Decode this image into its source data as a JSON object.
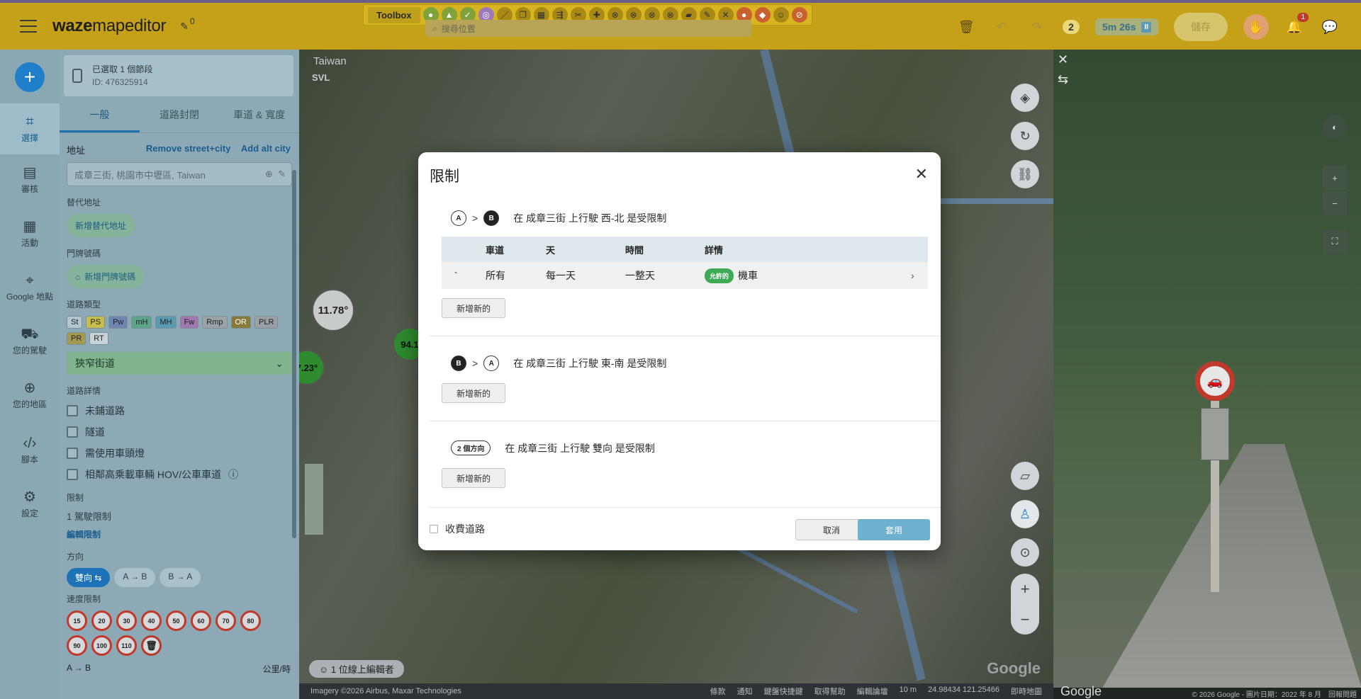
{
  "topbar": {
    "logo_bold": "waze",
    "logo_rest": "mapeditor",
    "edit_count": "0",
    "toolbox_label": "Toolbox",
    "search_placeholder": "搜尋位置",
    "pending_count": "2",
    "timer": "5m 26s",
    "save_label": "儲存",
    "notif_count": "1"
  },
  "rail": {
    "items": [
      {
        "label": "選擇",
        "icon": "select-icon"
      },
      {
        "label": "審核",
        "icon": "review-icon"
      },
      {
        "label": "活動",
        "icon": "calendar-icon"
      },
      {
        "label": "Google 地點",
        "icon": "place-pin-icon"
      },
      {
        "label": "您的駕駛",
        "icon": "car-icon"
      },
      {
        "label": "您的地區",
        "icon": "globe-icon"
      },
      {
        "label": "腳本",
        "icon": "code-icon"
      },
      {
        "label": "設定",
        "icon": "gear-icon"
      }
    ]
  },
  "panel": {
    "selected": "已選取 1 個節段",
    "segment_id": "ID: 476325914",
    "tabs": [
      "一般",
      "道路封閉",
      "車道 & 寬度"
    ],
    "address_label": "地址",
    "remove_street": "Remove street+city",
    "add_alt_city": "Add alt city",
    "address_value": "成章三街, 桃園市中壢區, Taiwan",
    "alt_address_label": "替代地址",
    "add_alt_address": "新增替代地址",
    "house_numbers_label": "門牌號碼",
    "add_house_numbers": "新增門牌號碼",
    "road_type_label": "道路類型",
    "road_types": [
      "St",
      "PS",
      "Pw",
      "mH",
      "MH",
      "Fw",
      "Rmp",
      "OR",
      "PLR",
      "PR",
      "RT"
    ],
    "road_type_value": "狹窄街道",
    "road_details_label": "道路詳情",
    "checkboxes": [
      "未鋪道路",
      "隧道",
      "需使用車頭燈",
      "相鄰高乘載車輛 HOV/公車車道"
    ],
    "restrictions_label": "限制",
    "restrictions_count": "1 駕駛限制",
    "edit_restrictions": "編輯限制",
    "direction_label": "方向",
    "directions": [
      "雙向 ⇆",
      "A → B",
      "B → A"
    ],
    "speed_label": "速度限制",
    "speeds": [
      "15",
      "20",
      "30",
      "40",
      "50",
      "60",
      "70",
      "80",
      "90",
      "100",
      "110"
    ],
    "ab_label": "A → B",
    "ab_value": "公里/時"
  },
  "map": {
    "country": "Taiwan",
    "svl": "SVL",
    "bubble1": "11.78°",
    "bubble2": "94.1",
    "bubble3": "7.23°",
    "editors_online": "1 位線上編輯者",
    "google": "Google",
    "imagery": "Imagery ©2026 Airbus, Maxar Technologies",
    "footer_links": [
      "條款",
      "通知",
      "鍵盤快捷鍵",
      "取得幫助",
      "編輯論壇"
    ],
    "scale": "10 m",
    "coords": "24.98434 121.25466",
    "live_map": "即時地圖"
  },
  "streetview": {
    "google": "Google",
    "copyright": "© 2026 Google - 圖片日期：2022 年 8 月",
    "report": "回報問題"
  },
  "modal": {
    "title": "限制",
    "rules": [
      {
        "from": "A",
        "to": "B",
        "text": "在 成章三街 上行駛 西-北 是受限制"
      },
      {
        "from": "B",
        "to": "A",
        "text": "在 成章三街 上行駛 東-南 是受限制"
      },
      {
        "badge": "2 個方向",
        "text": "在 成章三街 上行駛 雙向 是受限制"
      }
    ],
    "table": {
      "headers": [
        "車道",
        "天",
        "時間",
        "詳情"
      ],
      "row": {
        "mark": "`",
        "lane": "所有",
        "days": "每一天",
        "time": "一整天",
        "allowed": "允許的",
        "vehicle": "機車"
      }
    },
    "add_new": "新增新的",
    "toll_label": "收費道路",
    "cancel": "取消",
    "apply": "套用"
  }
}
